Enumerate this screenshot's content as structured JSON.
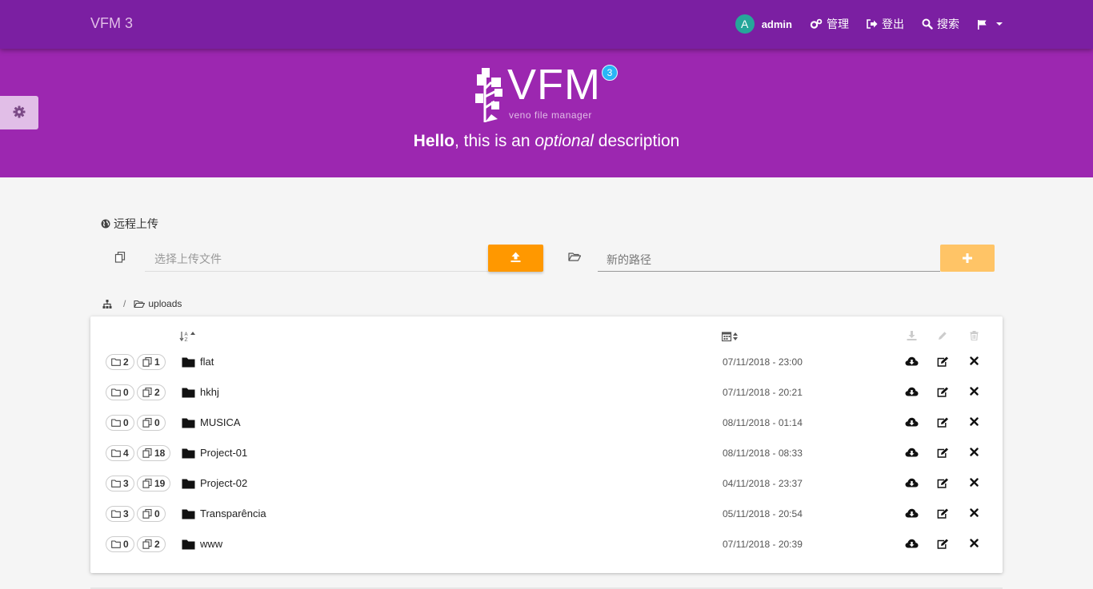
{
  "app": {
    "title": "VFM 3"
  },
  "nav": {
    "user_initial": "A",
    "username": "admin",
    "admin_label": "管理",
    "logout_label": "登出",
    "search_label": "搜索"
  },
  "hero": {
    "logo_text": "VFM",
    "logo_version": "3",
    "logo_subtitle": "veno file manager",
    "desc_bold": "Hello",
    "desc_part1": ", this is an ",
    "desc_italic": "optional",
    "desc_part2": " description"
  },
  "upload": {
    "remote_title": "远程上传",
    "file_placeholder": "选择上传文件",
    "path_placeholder": "新的路径"
  },
  "breadcrumb": {
    "separator": "/",
    "current": "uploads"
  },
  "rows": [
    {
      "folders": "2",
      "files": "1",
      "name": "flat",
      "date": "07/11/2018 - 23:00"
    },
    {
      "folders": "0",
      "files": "2",
      "name": "hkhj",
      "date": "07/11/2018 - 20:21"
    },
    {
      "folders": "0",
      "files": "0",
      "name": "MUSICA",
      "date": "08/11/2018 - 01:14"
    },
    {
      "folders": "4",
      "files": "18",
      "name": "Project-01",
      "date": "08/11/2018 - 08:33"
    },
    {
      "folders": "3",
      "files": "19",
      "name": "Project-02",
      "date": "04/11/2018 - 23:37"
    },
    {
      "folders": "3",
      "files": "0",
      "name": "Transparência",
      "date": "05/11/2018 - 20:54"
    },
    {
      "folders": "0",
      "files": "2",
      "name": "www",
      "date": "07/11/2018 - 20:39"
    }
  ],
  "colors": {
    "navbar": "#7b1fa2",
    "hero": "#9c27b0",
    "accent": "#ff9800",
    "avatar": "#26a69a"
  }
}
